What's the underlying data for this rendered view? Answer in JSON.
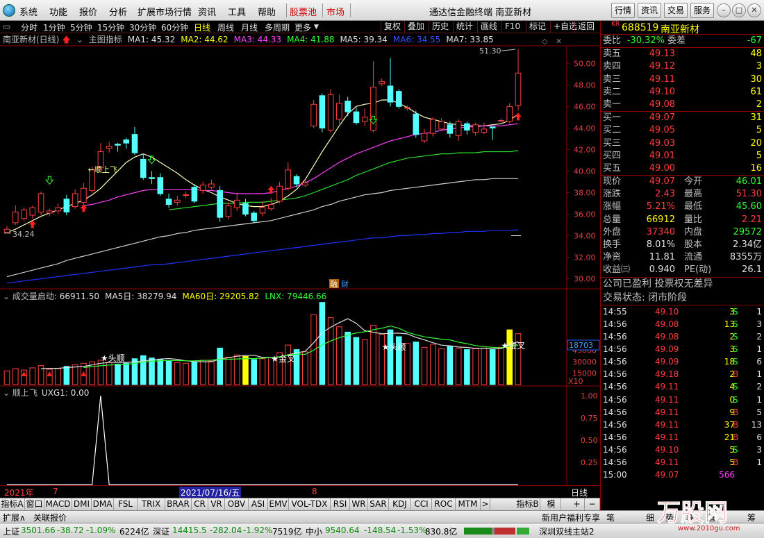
{
  "menubar": {
    "items": [
      "系统",
      "功能",
      "报价",
      "分析",
      "扩展市场行情",
      "资讯",
      "工具",
      "帮助"
    ],
    "red_items": [
      "股票池",
      "市场"
    ],
    "window_title": "通达信金融终端  南亚新材",
    "right_buttons": [
      "行情",
      "资讯",
      "交易",
      "服务"
    ]
  },
  "toolbar": {
    "periods": [
      "分时",
      "1分钟",
      "5分钟",
      "15分钟",
      "30分钟",
      "60分钟",
      "日线",
      "周线",
      "月线",
      "多周期",
      "更多"
    ],
    "active": "日线",
    "right": [
      "复权",
      "叠加",
      "历史",
      "统计",
      "画线",
      "F10",
      "标记",
      "+自选",
      "返回"
    ]
  },
  "main_info": {
    "name": "南亚新材(日线)",
    "indicator": "主图指标",
    "ma1": "MA1: 45.32",
    "ma2": "MA2: 44.62",
    "ma3": "MA3: 44.33",
    "ma4": "MA4: 41.88",
    "ma5": "MA5: 39.34",
    "ma6": "MA6: 34.55",
    "ma7": "MA7: 33.85"
  },
  "main_chart": {
    "y_ticks": [
      "50.00",
      "48.00",
      "46.00",
      "44.00",
      "42.00",
      "40.00",
      "38.00",
      "36.00",
      "34.00",
      "32.00",
      "30.00"
    ],
    "high_label": "51.30",
    "low_label": "34.24",
    "signal_label": "顺上飞",
    "badges": [
      "融",
      "财"
    ],
    "candles": [
      [
        34.3,
        34.6,
        34.2,
        34.9
      ],
      [
        35.2,
        36.2,
        35.0,
        36.8
      ],
      [
        35.6,
        36.4,
        35.4,
        36.6
      ],
      [
        35.9,
        36.6,
        35.6,
        36.8
      ],
      [
        36.2,
        37.9,
        35.9,
        38.1
      ],
      [
        36.1,
        36.3,
        35.8,
        36.5
      ],
      [
        36.3,
        36.6,
        36.0,
        37.0
      ],
      [
        37.4,
        36.2,
        35.9,
        37.8
      ],
      [
        36.7,
        37.9,
        36.5,
        38.3
      ],
      [
        37.1,
        38.4,
        36.8,
        38.9
      ],
      [
        38.2,
        40.1,
        38.0,
        40.4
      ],
      [
        40.3,
        41.8,
        40.1,
        42.6
      ],
      [
        42.1,
        42.3,
        41.7,
        42.7
      ],
      [
        42.5,
        42.4,
        41.8,
        42.6
      ],
      [
        42.9,
        42.6,
        42.1,
        43.1
      ],
      [
        43.4,
        41.7,
        41.5,
        44.1
      ],
      [
        41.1,
        39.4,
        39.2,
        41.6
      ],
      [
        39.4,
        39.3,
        38.8,
        40.0
      ],
      [
        39.4,
        37.9,
        37.7,
        39.8
      ],
      [
        37.4,
        36.9,
        36.6,
        37.9
      ],
      [
        37.1,
        37.3,
        36.8,
        37.7
      ],
      [
        37.8,
        37.8,
        37.5,
        38.1
      ],
      [
        38.5,
        37.2,
        37.0,
        38.8
      ],
      [
        38.2,
        38.7,
        37.9,
        39.0
      ],
      [
        38.5,
        38.8,
        38.3,
        39.2
      ],
      [
        38.2,
        35.7,
        35.3,
        38.6
      ],
      [
        35.8,
        36.8,
        35.5,
        37.1
      ],
      [
        36.6,
        37.3,
        36.3,
        38.0
      ],
      [
        37.0,
        36.0,
        35.8,
        37.4
      ],
      [
        36.1,
        35.4,
        35.2,
        36.3
      ],
      [
        36.1,
        36.6,
        35.8,
        37.2
      ],
      [
        36.5,
        36.9,
        36.3,
        37.5
      ],
      [
        37.2,
        38.6,
        37.0,
        39.0
      ],
      [
        38.4,
        40.1,
        38.2,
        40.8
      ],
      [
        39.5,
        38.8,
        38.5,
        39.7
      ],
      [
        38.7,
        38.9,
        38.5,
        39.2
      ],
      [
        44.2,
        46.2,
        44.0,
        46.6
      ],
      [
        47.0,
        44.0,
        43.6,
        47.2
      ],
      [
        43.8,
        47.1,
        43.6,
        47.6
      ],
      [
        44.8,
        46.3,
        44.4,
        47.1
      ],
      [
        46.5,
        45.5,
        45.1,
        46.9
      ],
      [
        45.5,
        44.5,
        44.3,
        45.9
      ],
      [
        44.6,
        45.0,
        44.2,
        45.8
      ],
      [
        43.8,
        47.8,
        43.6,
        50.2
      ],
      [
        48.1,
        48.3,
        47.9,
        48.6
      ],
      [
        47.9,
        46.4,
        46.0,
        50.5
      ],
      [
        47.4,
        46.0,
        45.8,
        47.6
      ],
      [
        45.9,
        45.9,
        45.6,
        46.1
      ],
      [
        45.3,
        43.4,
        43.1,
        45.6
      ],
      [
        42.8,
        43.5,
        42.6,
        43.9
      ],
      [
        43.5,
        44.8,
        43.2,
        45.0
      ],
      [
        43.9,
        44.6,
        43.8,
        44.9
      ],
      [
        44.3,
        43.5,
        43.1,
        44.6
      ],
      [
        43.3,
        44.6,
        42.8,
        44.8
      ],
      [
        44.4,
        43.8,
        43.4,
        44.6
      ],
      [
        43.6,
        44.3,
        43.3,
        44.5
      ],
      [
        43.6,
        43.9,
        43.4,
        44.5
      ],
      [
        44.1,
        44.0,
        42.9,
        44.1
      ],
      [
        44.7,
        44.7,
        44.5,
        44.9
      ],
      [
        44.6,
        46.0,
        44.4,
        46.3
      ],
      [
        46.1,
        49.1,
        45.6,
        51.3
      ]
    ],
    "ma_series": [
      {
        "color": "#ffffc0",
        "values": [
          34.3,
          34.6,
          35.0,
          35.4,
          35.8,
          36.1,
          36.4,
          36.7,
          37.0,
          37.3,
          37.8,
          38.4,
          39.2,
          40.0,
          40.8,
          41.3,
          41.6,
          41.3,
          40.8,
          40.3,
          39.8,
          39.2,
          38.7,
          38.3,
          38.0,
          37.6,
          37.3,
          37.0,
          36.8,
          36.7,
          36.7,
          36.9,
          37.2,
          37.7,
          38.3,
          39.2,
          40.5,
          41.8,
          43.0,
          44.2,
          45.3,
          46.0,
          46.2,
          46.3,
          46.6,
          46.6,
          46.3,
          45.9,
          45.4,
          45.0,
          44.8,
          44.6,
          44.4,
          44.3,
          44.2,
          44.2,
          44.2,
          44.3,
          44.4,
          44.7,
          45.3
        ]
      },
      {
        "color": "#ff40ff",
        "values": [
          null,
          null,
          null,
          null,
          null,
          null,
          null,
          null,
          null,
          36.8,
          36.9,
          37.1,
          37.3,
          37.6,
          37.8,
          38.0,
          38.2,
          38.3,
          38.3,
          38.3,
          38.3,
          38.3,
          38.3,
          38.2,
          38.2,
          38.1,
          38.0,
          37.9,
          37.9,
          37.9,
          37.9,
          38.0,
          38.2,
          38.4,
          38.6,
          38.9,
          39.3,
          39.8,
          40.3,
          40.8,
          41.2,
          41.6,
          41.9,
          42.2,
          42.5,
          42.8,
          43.0,
          43.2,
          43.4,
          43.5,
          43.6,
          43.8,
          43.9,
          44.0,
          44.1,
          44.1,
          44.2,
          44.2,
          44.2,
          44.3,
          44.4
        ]
      },
      {
        "color": "#30e030",
        "values": [
          null,
          null,
          null,
          null,
          null,
          null,
          null,
          null,
          null,
          null,
          null,
          null,
          null,
          null,
          null,
          null,
          null,
          null,
          null,
          36.4,
          36.5,
          36.6,
          36.7,
          36.8,
          36.9,
          37.0,
          37.0,
          37.0,
          37.1,
          37.1,
          37.1,
          37.2,
          37.3,
          37.4,
          37.5,
          37.7,
          38.0,
          38.3,
          38.6,
          38.9,
          39.2,
          39.6,
          39.9,
          40.2,
          40.5,
          40.8,
          41.0,
          41.2,
          41.3,
          41.4,
          41.5,
          41.6,
          41.6,
          41.7,
          41.7,
          41.7,
          41.8,
          41.8,
          41.8,
          41.8,
          41.9
        ]
      },
      {
        "color": "#d0d0d0",
        "values": [
          30.2,
          30.4,
          30.6,
          30.8,
          31.0,
          31.2,
          31.4,
          31.7,
          31.9,
          32.1,
          32.3,
          32.5,
          32.7,
          32.9,
          33.1,
          33.3,
          33.5,
          33.7,
          33.9,
          34.0,
          34.2,
          34.3,
          34.5,
          34.6,
          34.7,
          34.8,
          34.9,
          35.0,
          35.1,
          35.2,
          35.3,
          35.4,
          35.6,
          35.8,
          36.0,
          36.2,
          36.4,
          36.7,
          36.9,
          37.2,
          37.4,
          37.6,
          37.8,
          37.9,
          38.0,
          38.2,
          38.3,
          38.4,
          38.5,
          38.6,
          38.7,
          38.8,
          38.9,
          39.0,
          39.1,
          39.2,
          39.2,
          39.3,
          39.3,
          39.3,
          39.3
        ]
      },
      {
        "color": "#2030ff",
        "values": [
          29.6,
          29.7,
          29.8,
          29.9,
          30.0,
          30.1,
          30.2,
          30.3,
          30.4,
          30.5,
          30.6,
          30.7,
          30.8,
          30.9,
          31.0,
          31.1,
          31.2,
          31.3,
          31.3,
          31.4,
          31.5,
          31.6,
          31.7,
          31.8,
          31.9,
          32.0,
          32.1,
          32.2,
          32.3,
          32.4,
          32.5,
          32.6,
          32.7,
          32.8,
          32.9,
          33.0,
          33.1,
          33.2,
          33.3,
          33.4,
          33.5,
          33.6,
          33.7,
          33.8,
          33.8,
          33.9,
          34.0,
          34.0,
          34.1,
          34.1,
          34.2,
          34.2,
          34.3,
          34.3,
          34.4,
          34.4,
          34.4,
          34.5,
          34.5,
          34.5,
          34.55
        ]
      }
    ]
  },
  "vol_info": {
    "name": "成交量启动",
    "value": ": 66911.50",
    "ma5": "MA5日: 38279.94",
    "ma60": "MA60日: 29205.82",
    "lnx": "LNX: 79446.66"
  },
  "vol_chart": {
    "y_ticks": [
      "45000",
      "30000",
      "15000"
    ],
    "current_label": "18703",
    "unit": "X10",
    "annotations": [
      "头顺",
      "金叉",
      "头顺",
      "金叉"
    ],
    "volumes": [
      1800,
      2100,
      1900,
      2200,
      2500,
      2000,
      2100,
      2400,
      2600,
      2800,
      3000,
      3200,
      2900,
      2700,
      2800,
      3400,
      3800,
      3500,
      3300,
      3100,
      2900,
      2800,
      3000,
      3200,
      3100,
      4800,
      3600,
      3900,
      3700,
      3300,
      3400,
      3500,
      4200,
      5200,
      4600,
      4300,
      9200,
      10800,
      8800,
      7600,
      6900,
      6200,
      5900,
      7800,
      6600,
      7200,
      6300,
      5400,
      5600,
      4900,
      5300,
      4700,
      5000,
      4800,
      4600,
      4700,
      4800,
      4600,
      4900,
      7200,
      6690
    ]
  },
  "ind_info": {
    "name": "顺上飞",
    "value": "UXG1: 0.00"
  },
  "ind_chart": {
    "y_ticks": [
      "1.00",
      "0.75",
      "0.50",
      "0.25"
    ]
  },
  "date_bar": {
    "year": "2021年",
    "m7": "7",
    "cursor": "2021/07/16/五",
    "m8": "8",
    "period": "日线"
  },
  "index_tabs": [
    "指标A",
    "窗口",
    "MACD",
    "DMI",
    "DMA",
    "FSL",
    "TRIX",
    "BRAR",
    "CR",
    "VR",
    "OBV",
    "ASI",
    "EMV",
    "VOL-TDX",
    "RSI",
    "WR",
    "SAR",
    "KDJ",
    "CCI",
    "ROC",
    "MTM"
  ],
  "index_right": [
    "指标B",
    "模",
    "板"
  ],
  "statusbar": {
    "items": [
      "扩展∧",
      "关联报价"
    ]
  },
  "quote": {
    "code": "688519",
    "name": "南亚新材",
    "kr": "KR",
    "weibi_label": "委比",
    "weibi": "-30.32%",
    "weicha_label": "委差",
    "weicha": "-67",
    "asks": [
      {
        "label": "卖五",
        "price": "49.13",
        "vol": "48"
      },
      {
        "label": "卖四",
        "price": "49.12",
        "vol": "3"
      },
      {
        "label": "卖三",
        "price": "49.11",
        "vol": "30"
      },
      {
        "label": "卖二",
        "price": "49.10",
        "vol": "61"
      },
      {
        "label": "卖一",
        "price": "49.08",
        "vol": "2"
      }
    ],
    "bids": [
      {
        "label": "买一",
        "price": "49.07",
        "vol": "31"
      },
      {
        "label": "买二",
        "price": "49.05",
        "vol": "5"
      },
      {
        "label": "买三",
        "price": "49.03",
        "vol": "20"
      },
      {
        "label": "买四",
        "price": "49.01",
        "vol": "5"
      },
      {
        "label": "买五",
        "price": "49.00",
        "vol": "16"
      }
    ],
    "stats": [
      [
        {
          "l": "现价",
          "v": "49.07",
          "c": "red"
        },
        {
          "l": "今开",
          "v": "46.01",
          "c": "grn"
        }
      ],
      [
        {
          "l": "涨跌",
          "v": "2.43",
          "c": "red"
        },
        {
          "l": "最高",
          "v": "51.30",
          "c": "red"
        }
      ],
      [
        {
          "l": "涨幅",
          "v": "5.21%",
          "c": "red"
        },
        {
          "l": "最低",
          "v": "45.60",
          "c": "grn"
        }
      ],
      [
        {
          "l": "总量",
          "v": "66912",
          "c": "yel"
        },
        {
          "l": "量比",
          "v": "2.21",
          "c": "red"
        }
      ],
      [
        {
          "l": "外盘",
          "v": "37340",
          "c": "red"
        },
        {
          "l": "内盘",
          "v": "29572",
          "c": "grn"
        }
      ],
      [
        {
          "l": "换手",
          "v": "8.01%",
          "c": "wht"
        },
        {
          "l": "股本",
          "v": "2.34亿",
          "c": "wht"
        }
      ],
      [
        {
          "l": "净资",
          "v": "11.81",
          "c": "wht"
        },
        {
          "l": "流通",
          "v": "8355万",
          "c": "wht"
        }
      ],
      [
        {
          "l": "收益㈢",
          "v": "0.940",
          "c": "wht"
        },
        {
          "l": "PE(动)",
          "v": "26.1",
          "c": "wht"
        }
      ]
    ],
    "notice1": "公司已盈利 投票权无差异",
    "notice2": "交易状态: 闭市阶段",
    "trades": [
      {
        "t": "14:55",
        "p": "49.10",
        "v": "3",
        "s": "S",
        "n": "1"
      },
      {
        "t": "14:56",
        "p": "49.08",
        "v": "13",
        "s": "S",
        "n": "3"
      },
      {
        "t": "14:56",
        "p": "49.08",
        "v": "2",
        "s": "S",
        "n": "2"
      },
      {
        "t": "14:56",
        "p": "49.09",
        "v": "3",
        "s": "S",
        "n": "1"
      },
      {
        "t": "14:56",
        "p": "49.09",
        "v": "18",
        "s": "S",
        "n": "6"
      },
      {
        "t": "14:56",
        "p": "49.18",
        "v": "2",
        "s": "B",
        "n": "1"
      },
      {
        "t": "14:56",
        "p": "49.11",
        "v": "4",
        "s": "S",
        "n": "2"
      },
      {
        "t": "14:56",
        "p": "49.11",
        "v": "0",
        "s": "S",
        "n": "1"
      },
      {
        "t": "14:56",
        "p": "49.11",
        "v": "9",
        "s": "B",
        "n": "5"
      },
      {
        "t": "14:56",
        "p": "49.11",
        "v": "37",
        "s": "B",
        "n": "13"
      },
      {
        "t": "14:56",
        "p": "49.11",
        "v": "21",
        "s": "B",
        "n": "6"
      },
      {
        "t": "14:56",
        "p": "49.10",
        "v": "5",
        "s": "S",
        "n": "3"
      },
      {
        "t": "14:56",
        "p": "49.11",
        "v": "5",
        "s": "B",
        "n": "1"
      },
      {
        "t": "15:00",
        "p": "49.07",
        "v": "566",
        "s": "",
        "n": ""
      }
    ]
  },
  "rpbot": {
    "items": [
      "新用户福利专享",
      "笔",
      "细",
      "势",
      "联",
      "值",
      "筹"
    ]
  },
  "bottombar": {
    "sh_label": "上证",
    "sh": "3501.66",
    "sh_chg": "-38.72",
    "sh_pct": "-1.09%",
    "sh_amt": "6224亿",
    "sz_label": "深证",
    "sz": "14415.5",
    "sz_chg": "-282.04",
    "sz_pct": "-1.92%",
    "sz_amt": "7519亿",
    "zx_label": "中小",
    "zx": "9540.64",
    "zx_chg": "-148.54",
    "zx_pct": "-1.53%",
    "zx_amt": "830.8亿",
    "server": "深圳双线主站2"
  },
  "watermark": {
    "text": "万股网",
    "url": "www.2010gu.com"
  }
}
